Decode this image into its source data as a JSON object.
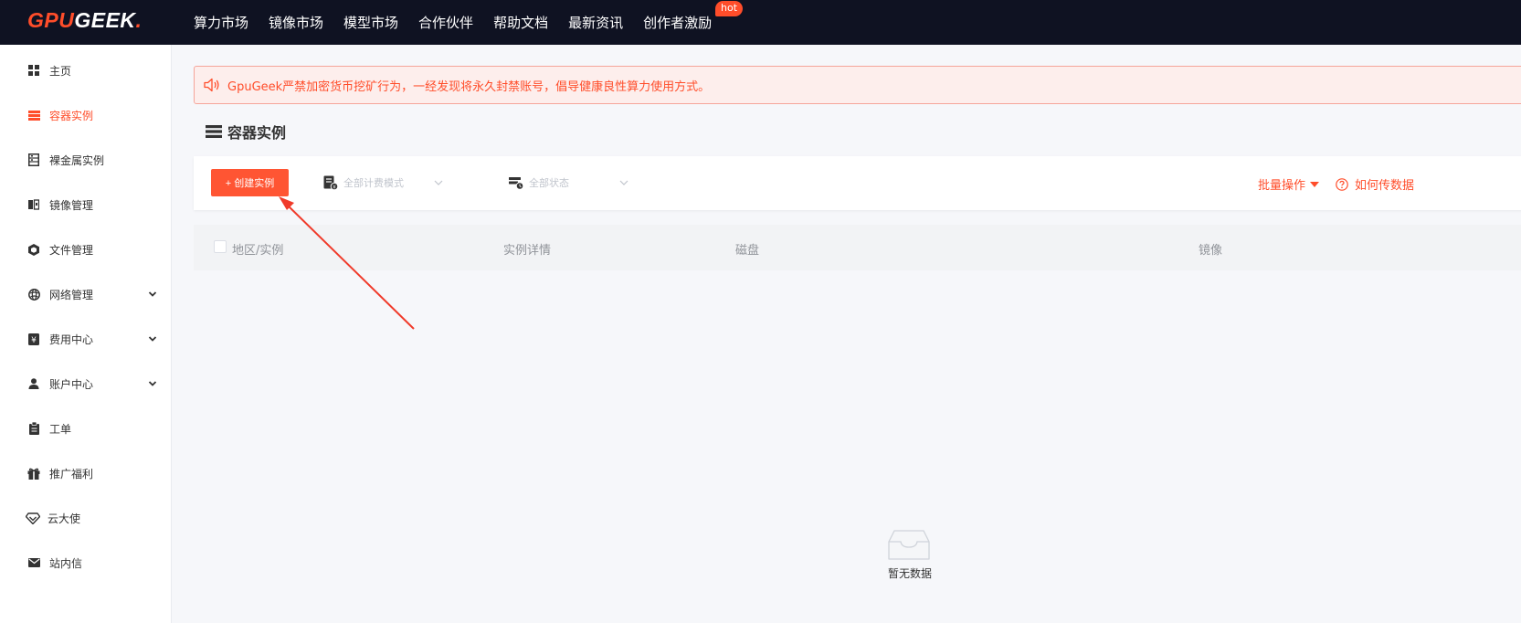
{
  "brand": {
    "logo_gpu": "GPU",
    "logo_geek": "GEEK",
    "logo_dot": ".",
    "accent": "#ff4d2a",
    "header_bg": "#0f1222"
  },
  "topnav": {
    "items": [
      {
        "label": "算力市场"
      },
      {
        "label": "镜像市场"
      },
      {
        "label": "模型市场"
      },
      {
        "label": "合作伙伴"
      },
      {
        "label": "帮助文档"
      },
      {
        "label": "最新资讯"
      },
      {
        "label": "创作者激励"
      }
    ],
    "hot_badge": "hot"
  },
  "sidebar": {
    "items": [
      {
        "label": "主页",
        "icon": "grid-icon"
      },
      {
        "label": "容器实例",
        "icon": "list-icon",
        "active": true
      },
      {
        "label": "裸金属实例",
        "icon": "server-icon"
      },
      {
        "label": "镜像管理",
        "icon": "image-icon"
      },
      {
        "label": "文件管理",
        "icon": "cube-icon"
      },
      {
        "label": "网络管理",
        "icon": "network-icon",
        "expandable": true
      },
      {
        "label": "费用中心",
        "icon": "yen-icon",
        "expandable": true
      },
      {
        "label": "账户中心",
        "icon": "user-icon",
        "expandable": true
      },
      {
        "label": "工单",
        "icon": "clipboard-icon"
      },
      {
        "label": "推广福利",
        "icon": "gift-icon"
      },
      {
        "label": "云大使",
        "icon": "diamond-icon"
      },
      {
        "label": "站内信",
        "icon": "mail-icon"
      }
    ]
  },
  "notice": {
    "text": "GpuGeek严禁加密货币挖矿行为，一经发现将永久封禁账号，倡导健康良性算力使用方式。"
  },
  "page": {
    "title": "容器实例"
  },
  "toolbar": {
    "create_label": "+ 创建实例",
    "billing_filter": {
      "placeholder": "全部计费模式"
    },
    "status_filter": {
      "placeholder": "全部状态"
    },
    "batch_label": "批量操作",
    "help_label": "如何传数据"
  },
  "table": {
    "columns": [
      "地区/实例",
      "实例详情",
      "磁盘",
      "镜像"
    ],
    "empty_text": "暂无数据"
  }
}
